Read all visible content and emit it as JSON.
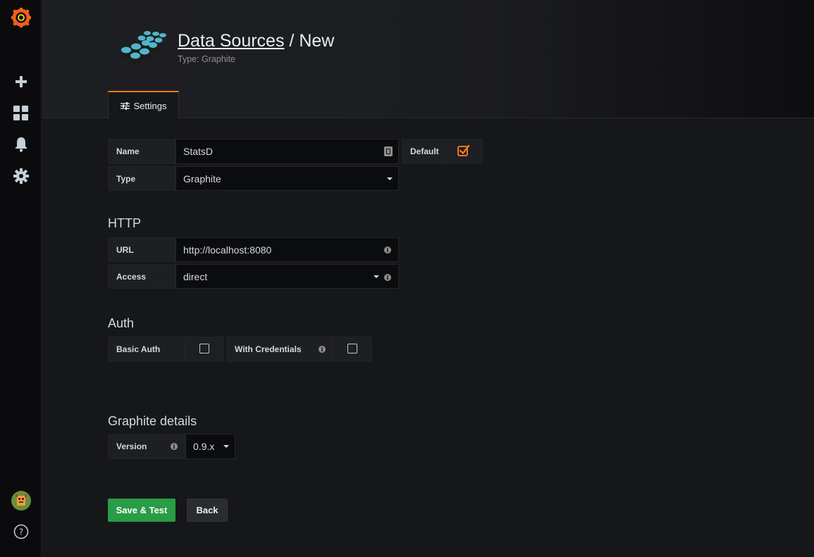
{
  "header": {
    "breadcrumb_link": "Data Sources",
    "separator": " / ",
    "title": "New",
    "subtitle": "Type: Graphite"
  },
  "tabs": [
    {
      "label": "Settings",
      "icon": "sliders-icon",
      "active": true
    }
  ],
  "form": {
    "name_label": "Name",
    "name_value": "StatsD",
    "default_label": "Default",
    "default_checked": true,
    "type_label": "Type",
    "type_value": "Graphite"
  },
  "http": {
    "title": "HTTP",
    "url_label": "URL",
    "url_value": "http://localhost:8080",
    "access_label": "Access",
    "access_value": "direct"
  },
  "auth": {
    "title": "Auth",
    "basic_auth_label": "Basic Auth",
    "basic_auth_checked": false,
    "with_credentials_label": "With Credentials",
    "with_credentials_checked": false
  },
  "graphite": {
    "title": "Graphite details",
    "version_label": "Version",
    "version_value": "0.9.x"
  },
  "buttons": {
    "save": "Save & Test",
    "back": "Back"
  },
  "colors": {
    "accent": "#eb7b18",
    "success": "#299c46"
  },
  "sidemenu": [
    "grafana-logo-icon",
    "plus-icon",
    "dashboards-icon",
    "bell-icon",
    "gear-icon",
    "avatar",
    "help-icon"
  ]
}
